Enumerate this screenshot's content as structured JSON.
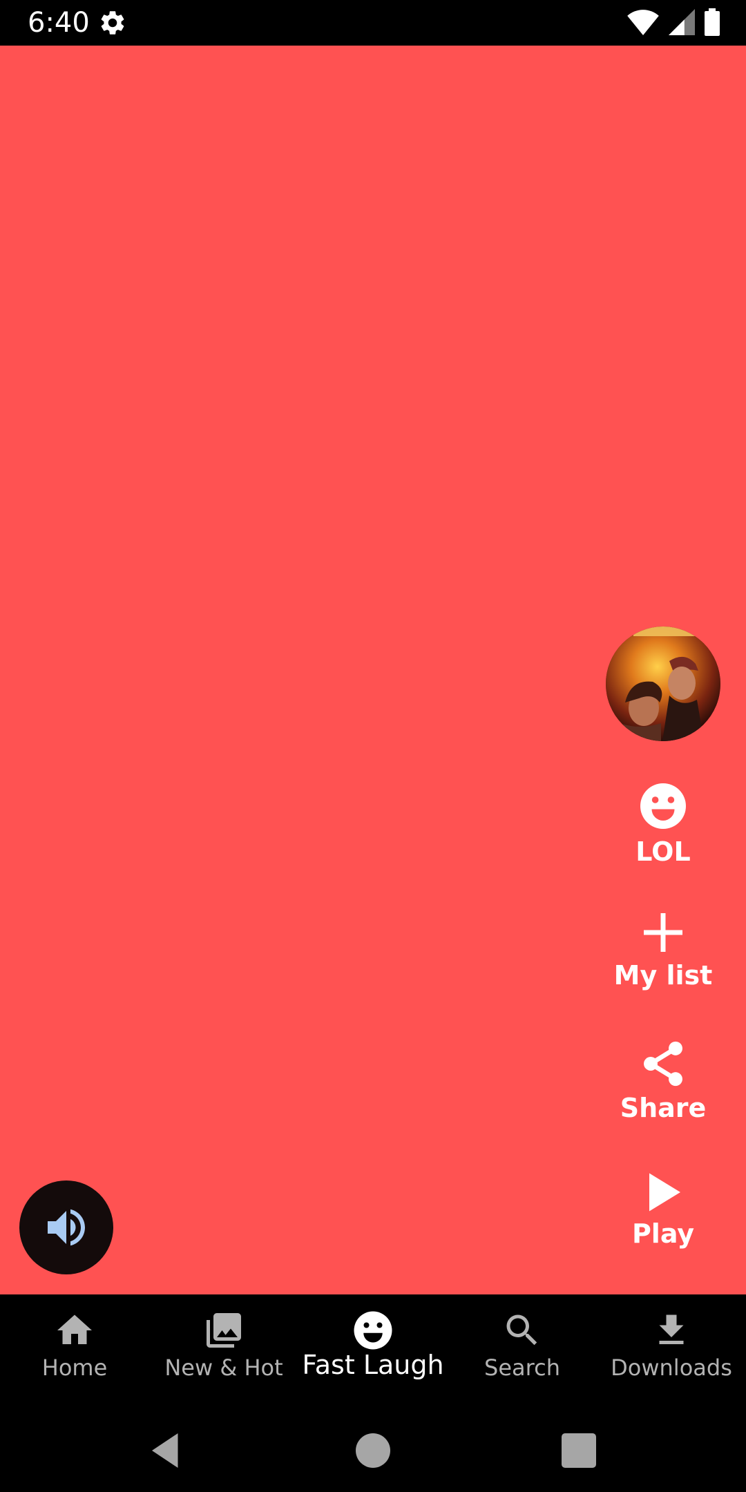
{
  "status_bar": {
    "time": "6:40",
    "icons": [
      "settings-icon",
      "wifi-icon",
      "cellular-signal-icon",
      "battery-icon"
    ]
  },
  "content": {
    "background_color": "#ff5252",
    "poster_alt": "title poster",
    "actions": [
      {
        "name": "lol",
        "label": "LOL",
        "icon": "laughing-face-icon"
      },
      {
        "name": "my-list",
        "label": "My list",
        "icon": "plus-icon"
      },
      {
        "name": "share",
        "label": "Share",
        "icon": "share-icon"
      },
      {
        "name": "play",
        "label": "Play",
        "icon": "play-icon"
      }
    ],
    "sound_icon": "volume-on-icon"
  },
  "bottom_nav": {
    "items": [
      {
        "label": "Home",
        "icon": "home-icon",
        "active": false
      },
      {
        "label": "New & Hot",
        "icon": "photo-library-icon",
        "active": false
      },
      {
        "label": "Fast Laugh",
        "icon": "laughing-face-icon",
        "active": true
      },
      {
        "label": "Search",
        "icon": "search-icon",
        "active": false
      },
      {
        "label": "Downloads",
        "icon": "download-icon",
        "active": false
      }
    ]
  },
  "system_nav": {
    "buttons": [
      "back-icon",
      "home-circle-icon",
      "recents-icon"
    ]
  }
}
